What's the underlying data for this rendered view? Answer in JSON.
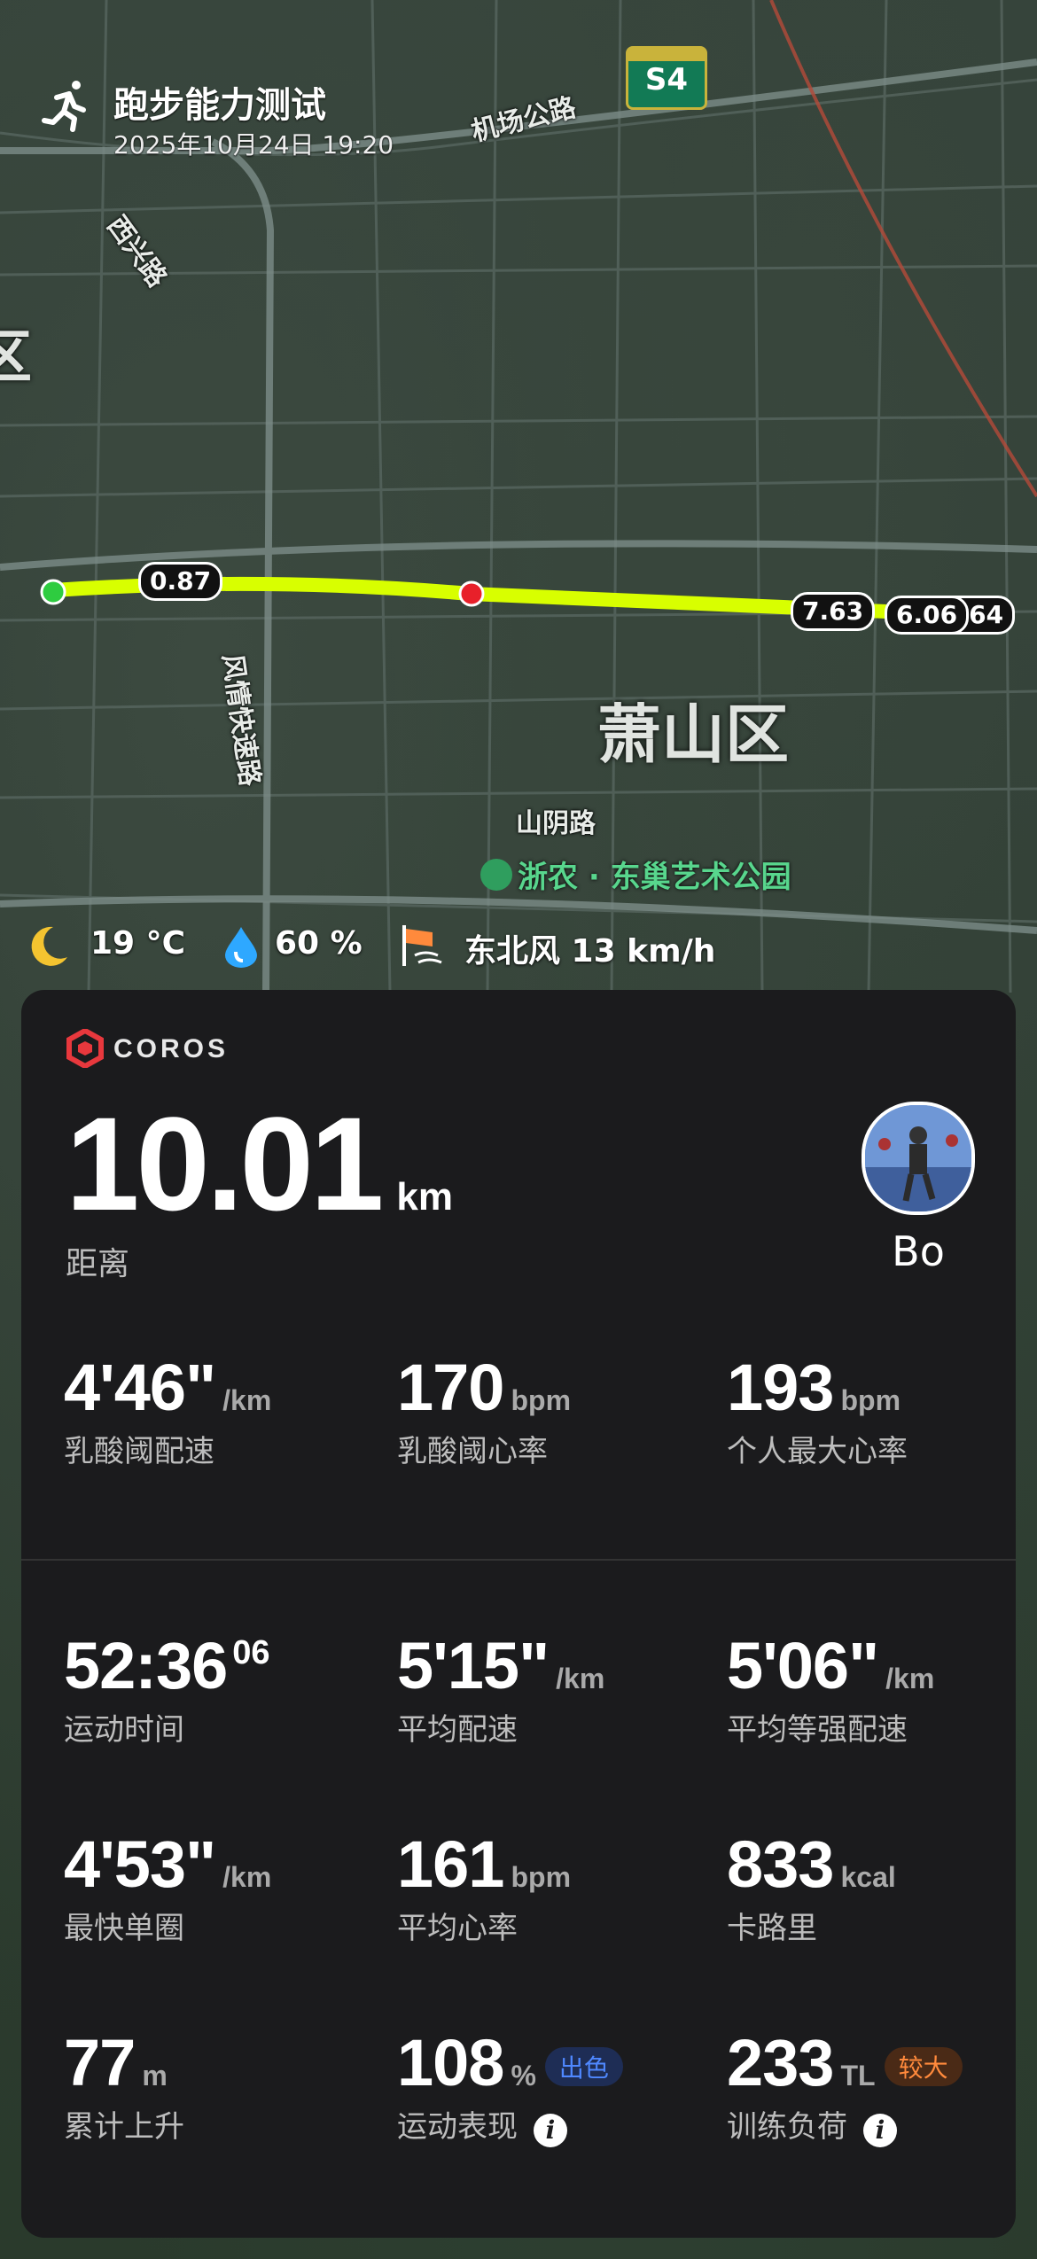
{
  "activity": {
    "title": "跑步能力测试",
    "datetime": "2025年10月24日 19:20"
  },
  "map": {
    "roads": [
      "机场公路",
      "西兴路",
      "风情快速路",
      "山阴路"
    ],
    "district_labels": [
      "萧山区",
      "区"
    ],
    "park": "浙农 · 东巢艺术公园",
    "highway_shield": "S4",
    "km_markers": [
      "0.87",
      "7.63",
      "6.06",
      "6.64"
    ],
    "route_color": "#d8ff00"
  },
  "weather": {
    "temperature": "19 °C",
    "humidity": "60 %",
    "wind": "东北风 13 km/h"
  },
  "card": {
    "brand": "COROS",
    "distance": {
      "value": "10.01",
      "unit": "km",
      "label": "距离"
    },
    "user": {
      "name": "Bo"
    },
    "threshold": [
      {
        "value": "4'46\"",
        "unit": "/km",
        "label": "乳酸阈配速"
      },
      {
        "value": "170",
        "unit": "bpm",
        "label": "乳酸阈心率"
      },
      {
        "value": "193",
        "unit": "bpm",
        "label": "个人最大心率"
      }
    ],
    "stats": [
      {
        "value": "52:36",
        "sup": "06",
        "label": "运动时间"
      },
      {
        "value": "5'15\"",
        "unit": "/km",
        "label": "平均配速"
      },
      {
        "value": "5'06\"",
        "unit": "/km",
        "label": "平均等强配速"
      },
      {
        "value": "4'53\"",
        "unit": "/km",
        "label": "最快单圈"
      },
      {
        "value": "161",
        "unit": "bpm",
        "label": "平均心率"
      },
      {
        "value": "833",
        "unit": "kcal",
        "label": "卡路里"
      },
      {
        "value": "77",
        "unit": "m",
        "label": "累计上升"
      },
      {
        "value": "108",
        "unit": "%",
        "label": "运动表现",
        "badge": "出色"
      },
      {
        "value": "233",
        "unit": "TL",
        "label": "训练负荷",
        "badge": "较大"
      }
    ],
    "colors": {
      "badge_good": "#4f88ff",
      "badge_high": "#ff8a3c",
      "brand_red": "#e8383d"
    }
  }
}
